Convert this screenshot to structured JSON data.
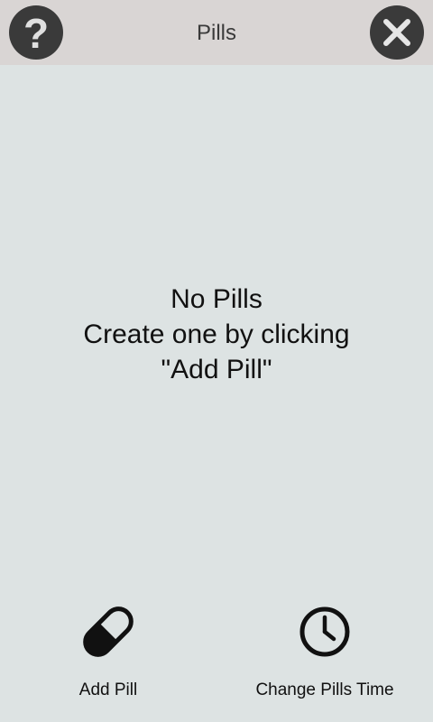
{
  "header": {
    "title": "Pills",
    "help_glyph": "?",
    "help_icon": "question-mark-icon",
    "close_icon": "close-x-icon"
  },
  "empty_state": {
    "line1": "No Pills",
    "line2": "Create one by clicking",
    "line3": "\"Add Pill\""
  },
  "actions": {
    "add_pill": {
      "label": "Add Pill",
      "icon": "pill-icon"
    },
    "change_time": {
      "label": "Change Pills Time",
      "icon": "clock-icon"
    }
  },
  "colors": {
    "background": "#dde3e3",
    "header": "#d9d5d4",
    "circle_button": "#3a3a3a"
  }
}
